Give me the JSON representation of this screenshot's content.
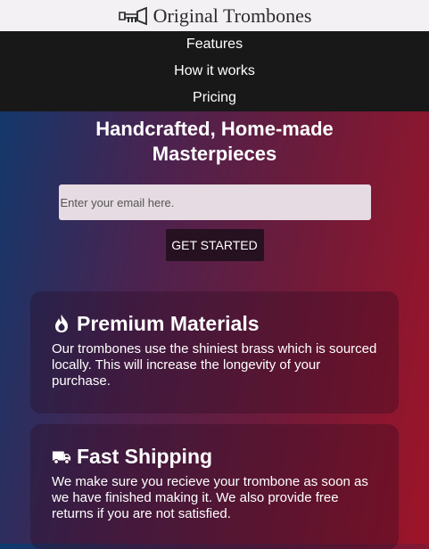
{
  "header": {
    "brand": "Original Trombones",
    "logo_icon": "trumpet-logo-icon"
  },
  "nav": {
    "items": [
      "Features",
      "How it works",
      "Pricing"
    ]
  },
  "hero": {
    "title_line1": "Handcrafted, Home-made",
    "title_line2": "Masterpieces",
    "email_placeholder": "Enter your email here.",
    "button_label": "GET STARTED"
  },
  "features": [
    {
      "icon": "fire-icon",
      "title": "Premium Materials",
      "text": "Our trombones use the shiniest brass which is sourced locally. This will increase the longevity of your purchase."
    },
    {
      "icon": "truck-icon",
      "title": "Fast Shipping",
      "text": "We make sure you recieve your trombone as soon as we have finished making it. We also provide free returns if you are not satisfied."
    }
  ],
  "colors": {
    "header_bg": "#f3f1f4",
    "nav_bg": "#181818",
    "gradient_left": "#0d3a6e",
    "gradient_right": "#9e1428",
    "button_bg": "#261121"
  }
}
